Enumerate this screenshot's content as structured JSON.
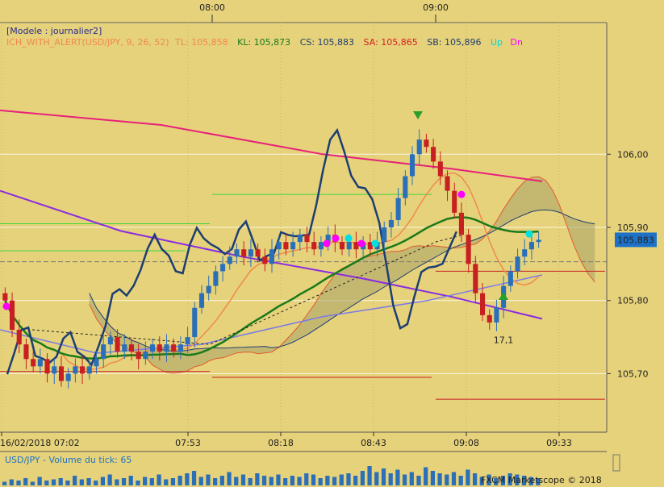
{
  "chart_data": {
    "type": "candlestick",
    "instrument": "USD/JPY",
    "model_label": "[Modele : journalier2]",
    "indicator": {
      "name": "ICH_WITH_ALERT(USD/JPY, 9, 26, 52)",
      "items": [
        {
          "key": "TL",
          "text": "TL: 105,858",
          "color": "#f08a4b"
        },
        {
          "key": "KL",
          "text": "KL: 105,873",
          "color": "#1a7a1a"
        },
        {
          "key": "CS",
          "text": "CS: 105,883",
          "color": "#1d3e72"
        },
        {
          "key": "SA",
          "text": "SA: 105,865",
          "color": "#d42020"
        },
        {
          "key": "SB",
          "text": "SB: 105,896",
          "color": "#1d3e72"
        },
        {
          "key": "Up",
          "text": "Up",
          "color": "#00e0e0"
        },
        {
          "key": "Dn",
          "text": "Dn",
          "color": "#ff00ff"
        }
      ]
    },
    "top_time_labels": [
      "08:00",
      "09:00"
    ],
    "x_tick_labels": [
      "16/02/2018 07:02",
      "07:53",
      "08:18",
      "08:43",
      "09:08",
      "09:33"
    ],
    "y_tick_labels": [
      "106,00",
      "105,90",
      "105,80",
      "105,70"
    ],
    "y_ticks": [
      106.0,
      105.9,
      105.8,
      105.7
    ],
    "ylim": [
      105.62,
      106.18
    ],
    "current_price": "105,883",
    "current_price_value": 105.883,
    "annotation": {
      "text": "17,1",
      "value": 105.755
    },
    "candle_closes": [
      105.8,
      105.76,
      105.74,
      105.72,
      105.71,
      105.72,
      105.7,
      105.71,
      105.69,
      105.7,
      105.71,
      105.7,
      105.71,
      105.72,
      105.74,
      105.75,
      105.73,
      105.74,
      105.73,
      105.72,
      105.73,
      105.74,
      105.73,
      105.74,
      105.73,
      105.74,
      105.75,
      105.79,
      105.81,
      105.82,
      105.84,
      105.85,
      105.86,
      105.87,
      105.86,
      105.87,
      105.86,
      105.85,
      105.87,
      105.88,
      105.87,
      105.88,
      105.89,
      105.88,
      105.87,
      105.88,
      105.89,
      105.88,
      105.87,
      105.88,
      105.87,
      105.88,
      105.87,
      105.88,
      105.9,
      105.91,
      105.94,
      105.97,
      106.0,
      106.02,
      106.01,
      105.99,
      105.97,
      105.95,
      105.92,
      105.89,
      105.85,
      105.81,
      105.78,
      105.77,
      105.79,
      105.82,
      105.84,
      105.86,
      105.87,
      105.88,
      105.883
    ],
    "volume": {
      "label": "USD/JPY - Volume du tick: 65",
      "values": [
        3,
        5,
        4,
        6,
        3,
        7,
        4,
        5,
        6,
        4,
        8,
        5,
        6,
        4,
        7,
        9,
        5,
        6,
        8,
        4,
        7,
        6,
        9,
        5,
        6,
        8,
        10,
        12,
        7,
        9,
        6,
        8,
        11,
        7,
        9,
        6,
        10,
        8,
        7,
        9,
        6,
        8,
        7,
        10,
        9,
        6,
        8,
        7,
        9,
        10,
        8,
        12,
        16,
        11,
        14,
        10,
        13,
        9,
        11,
        8,
        15,
        12,
        10,
        9,
        11,
        8,
        13,
        10,
        7,
        9,
        6,
        8,
        10,
        9,
        8,
        7,
        6
      ]
    },
    "copyright": "FXCM Marketscope © 2018",
    "colors": {
      "background": "#e6d27a",
      "up_candle": "#2a6fb8",
      "down_candle": "#c82020",
      "tenkan": "#f08a4b",
      "kijun": "#1a7a1a",
      "chikou": "#1d3e72",
      "ma_magenta": "#e8207a",
      "ma_purple": "#8a2be2",
      "ma_blue": "#7a7ae8"
    }
  }
}
